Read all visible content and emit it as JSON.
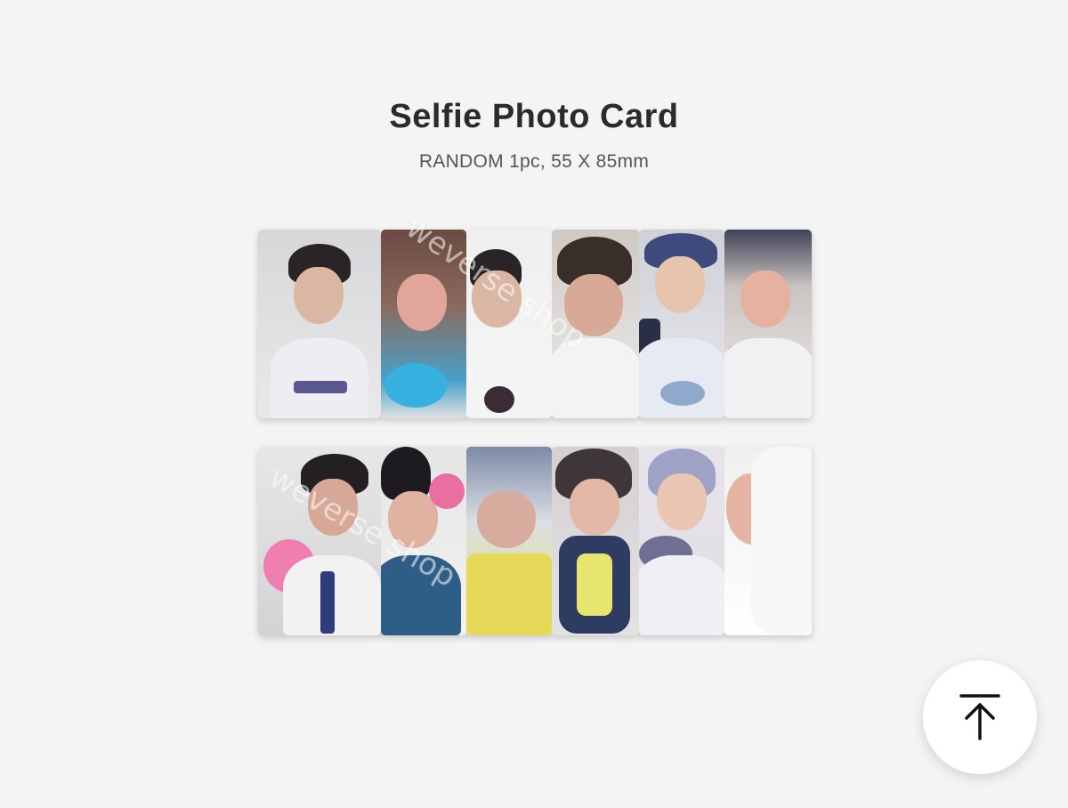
{
  "product": {
    "title": "Selfie Photo Card",
    "subtitle": "RANDOM 1pc, 55 X 85mm"
  },
  "watermark": {
    "brand": "weverse shop"
  },
  "photo_cards": {
    "row_1": [
      "card-1",
      "card-2",
      "card-3",
      "card-4",
      "card-5",
      "card-6"
    ],
    "row_2": [
      "card-7",
      "card-8",
      "card-9",
      "card-10",
      "card-11",
      "card-12"
    ]
  },
  "scroll_top_button": {
    "icon": "arrow-up-to-top-icon"
  },
  "colors": {
    "background": "#f4f4f4",
    "title": "#2b2b2b",
    "subtitle": "#555555"
  }
}
